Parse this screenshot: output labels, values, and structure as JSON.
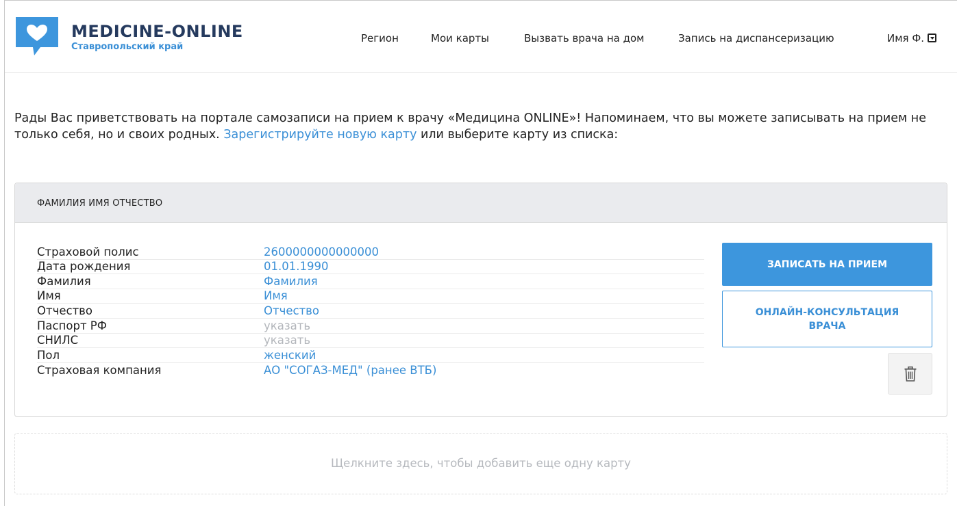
{
  "header": {
    "brand_title": "MEDICINE-ONLINE",
    "brand_subtitle": "Ставропольский край",
    "nav": {
      "region": "Регион",
      "my_cards": "Мои карты",
      "call_doctor": "Вызвать врача на дом",
      "dispensary": "Запись на диспансеризацию",
      "user": "Имя Ф."
    }
  },
  "welcome": {
    "text_before": "Рады Вас приветствовать на портале самозаписи на прием к врачу «Медицина ONLINE»! Напоминаем, что вы можете записывать на прием не только себя, но и своих родных. ",
    "link": "Зарегистрируйте новую карту",
    "text_after": " или выберите карту из списка:"
  },
  "card": {
    "header": "ФАМИЛИЯ ИМЯ ОТЧЕСТВО",
    "fields": [
      {
        "label": "Страховой полис",
        "value": "2600000000000000"
      },
      {
        "label": "Дата рождения",
        "value": "01.01.1990"
      },
      {
        "label": "Фамилия",
        "value": "Фамилия"
      },
      {
        "label": "Имя",
        "value": "Имя"
      },
      {
        "label": "Отчество",
        "value": "Отчество"
      },
      {
        "label": "Паспорт РФ",
        "value": "указать"
      },
      {
        "label": "СНИЛС",
        "value": "указать"
      },
      {
        "label": "Пол",
        "value": "женский"
      },
      {
        "label": "Страховая компания",
        "value": "АО \"СОГАЗ-МЕД\" (ранее ВТБ)"
      }
    ],
    "buttons": {
      "book": "ЗАПИСАТЬ НА ПРИЕМ",
      "online_consult": "ОНЛАЙН-КОНСУЛЬТАЦИЯ ВРАЧА"
    }
  },
  "add_card": "Щелкните здесь, чтобы добавить еще одну карту",
  "colors": {
    "accent": "#3d96dd",
    "link": "#3a8fd6",
    "brand_dark": "#253a5e",
    "muted": "#b3b6bb"
  },
  "icons": {
    "logo": "heart-speech-bubble-icon",
    "user_menu": "dropdown-box-icon",
    "delete": "trash-icon"
  }
}
